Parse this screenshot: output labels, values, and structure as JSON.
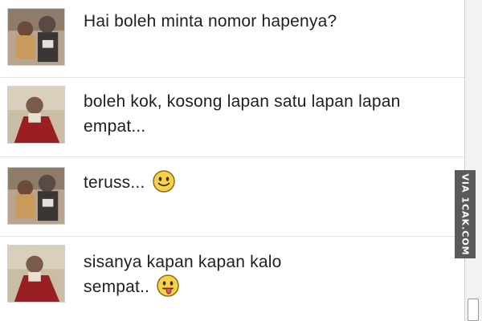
{
  "messages": [
    {
      "sender": "user-a",
      "lines": [
        "Hai boleh minta nomor hapenya?"
      ],
      "emoji": ""
    },
    {
      "sender": "user-b",
      "lines": [
        "boleh kok, kosong lapan satu lapan lapan",
        "empat..."
      ],
      "emoji": ""
    },
    {
      "sender": "user-a",
      "lines": [
        "teruss..."
      ],
      "emoji": "smiley-icon"
    },
    {
      "sender": "user-b",
      "lines": [
        "sisanya kapan kapan kalo",
        "sempat.."
      ],
      "emoji": "tongue-out-icon"
    }
  ],
  "watermark": "VIA 1CAK.COM",
  "colors": {
    "text": "#1f1f1f",
    "divider": "#e3e3e3",
    "emoji_face": "#f6d24a",
    "watermark_bg": "#5a5a5a"
  }
}
